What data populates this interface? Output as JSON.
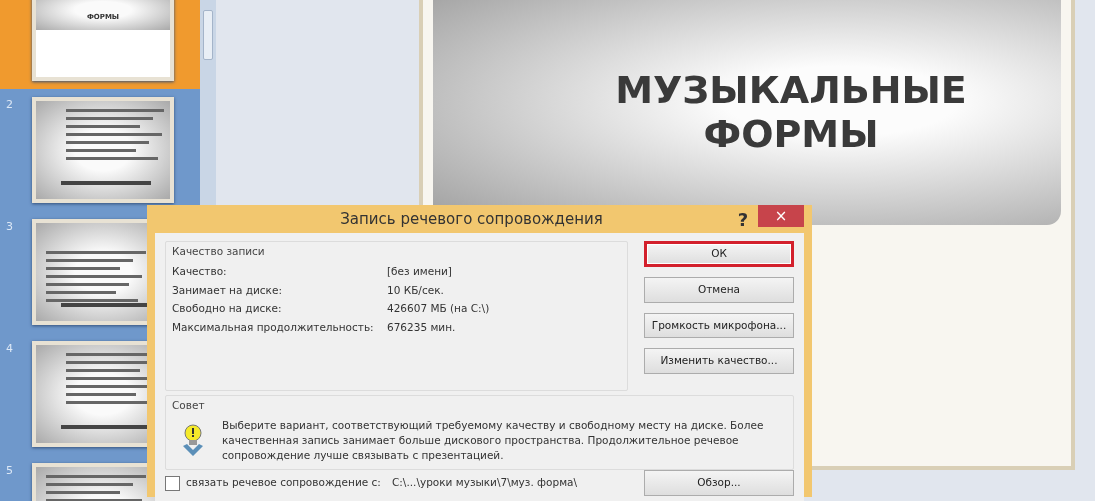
{
  "slides_panel": {
    "thumbnails": [
      {
        "title": "ФОРМЫ",
        "selected": true,
        "kind": "title"
      },
      {
        "number": "2",
        "selected": false,
        "kind": "text"
      },
      {
        "number": "3",
        "selected": false,
        "kind": "text"
      },
      {
        "number": "4",
        "selected": false,
        "kind": "text"
      },
      {
        "number": "5",
        "selected": false,
        "kind": "text"
      }
    ]
  },
  "slide": {
    "title": "МУЗЫКАЛЬНЫЕ ФОРМЫ"
  },
  "dialog": {
    "title": "Запись речевого сопровождения",
    "help": "?",
    "close": "×",
    "quality_group": {
      "legend": "Качество записи",
      "rows": [
        {
          "label": "Качество:",
          "value": "[без имени]"
        },
        {
          "label": "Занимает на диске:",
          "value": "10 КБ/сек."
        },
        {
          "label": "Свободно на диске:",
          "value": "426607 МБ (на C:\\)"
        },
        {
          "label": "Максимальная продолжительность:",
          "value": "676235 мин."
        }
      ]
    },
    "buttons": [
      {
        "label": "ОК",
        "highlighted": true
      },
      {
        "label": "Отмена",
        "highlighted": false
      },
      {
        "label": "Громкость микрофона...",
        "highlighted": false
      },
      {
        "label": "Изменить качество...",
        "highlighted": false
      }
    ],
    "tip_group": {
      "legend": "Совет",
      "text": "Выберите вариант, соответствующий требуемому качеству и свободному месту на диске. Более качественная запись занимает больше дискового пространства. Продолжительное речевое сопровождение лучше связывать с презентацией."
    },
    "link_option": {
      "label": "связать речевое сопровождение с:",
      "checked": false,
      "path": "C:\\...\\уроки музыки\\7\\муз. форма\\",
      "button": "Обзор..."
    }
  }
}
